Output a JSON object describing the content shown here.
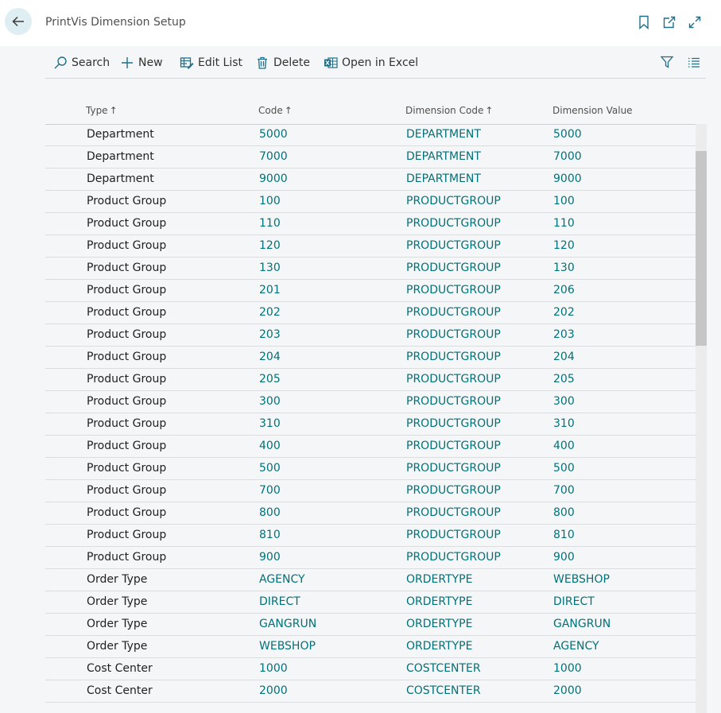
{
  "window": {
    "title": "PrintVis Dimension Setup"
  },
  "actions": {
    "search": "Search",
    "new": "New",
    "edit_list": "Edit List",
    "delete": "Delete",
    "open_in_excel": "Open in Excel"
  },
  "columns": {
    "type": "Type",
    "code": "Code",
    "dimension_code": "Dimension Code",
    "dimension_value": "Dimension Value",
    "sort_arrow": "↑"
  },
  "rows": [
    {
      "type": "Department",
      "code": "5000",
      "dimension_code": "DEPARTMENT",
      "dimension_value": "5000"
    },
    {
      "type": "Department",
      "code": "7000",
      "dimension_code": "DEPARTMENT",
      "dimension_value": "7000"
    },
    {
      "type": "Department",
      "code": "9000",
      "dimension_code": "DEPARTMENT",
      "dimension_value": "9000"
    },
    {
      "type": "Product Group",
      "code": "100",
      "dimension_code": "PRODUCTGROUP",
      "dimension_value": "100"
    },
    {
      "type": "Product Group",
      "code": "110",
      "dimension_code": "PRODUCTGROUP",
      "dimension_value": "110"
    },
    {
      "type": "Product Group",
      "code": "120",
      "dimension_code": "PRODUCTGROUP",
      "dimension_value": "120"
    },
    {
      "type": "Product Group",
      "code": "130",
      "dimension_code": "PRODUCTGROUP",
      "dimension_value": "130"
    },
    {
      "type": "Product Group",
      "code": "201",
      "dimension_code": "PRODUCTGROUP",
      "dimension_value": "206"
    },
    {
      "type": "Product Group",
      "code": "202",
      "dimension_code": "PRODUCTGROUP",
      "dimension_value": "202"
    },
    {
      "type": "Product Group",
      "code": "203",
      "dimension_code": "PRODUCTGROUP",
      "dimension_value": "203"
    },
    {
      "type": "Product Group",
      "code": "204",
      "dimension_code": "PRODUCTGROUP",
      "dimension_value": "204"
    },
    {
      "type": "Product Group",
      "code": "205",
      "dimension_code": "PRODUCTGROUP",
      "dimension_value": "205"
    },
    {
      "type": "Product Group",
      "code": "300",
      "dimension_code": "PRODUCTGROUP",
      "dimension_value": "300"
    },
    {
      "type": "Product Group",
      "code": "310",
      "dimension_code": "PRODUCTGROUP",
      "dimension_value": "310"
    },
    {
      "type": "Product Group",
      "code": "400",
      "dimension_code": "PRODUCTGROUP",
      "dimension_value": "400"
    },
    {
      "type": "Product Group",
      "code": "500",
      "dimension_code": "PRODUCTGROUP",
      "dimension_value": "500"
    },
    {
      "type": "Product Group",
      "code": "700",
      "dimension_code": "PRODUCTGROUP",
      "dimension_value": "700"
    },
    {
      "type": "Product Group",
      "code": "800",
      "dimension_code": "PRODUCTGROUP",
      "dimension_value": "800"
    },
    {
      "type": "Product Group",
      "code": "810",
      "dimension_code": "PRODUCTGROUP",
      "dimension_value": "810"
    },
    {
      "type": "Product Group",
      "code": "900",
      "dimension_code": "PRODUCTGROUP",
      "dimension_value": "900"
    },
    {
      "type": "Order Type",
      "code": "AGENCY",
      "dimension_code": "ORDERTYPE",
      "dimension_value": "WEBSHOP"
    },
    {
      "type": "Order Type",
      "code": "DIRECT",
      "dimension_code": "ORDERTYPE",
      "dimension_value": "DIRECT"
    },
    {
      "type": "Order Type",
      "code": "GANGRUN",
      "dimension_code": "ORDERTYPE",
      "dimension_value": "GANGRUN"
    },
    {
      "type": "Order Type",
      "code": "WEBSHOP",
      "dimension_code": "ORDERTYPE",
      "dimension_value": "AGENCY"
    },
    {
      "type": "Cost Center",
      "code": "1000",
      "dimension_code": "COSTCENTER",
      "dimension_value": "1000"
    },
    {
      "type": "Cost Center",
      "code": "2000",
      "dimension_code": "COSTCENTER",
      "dimension_value": "2000"
    }
  ],
  "icons": {
    "back": "back-arrow-icon",
    "bookmark": "bookmark-icon",
    "open_new_window": "open-new-window-icon",
    "expand": "expand-icon",
    "search": "search-icon",
    "new": "plus-icon",
    "edit_list": "edit-list-icon",
    "delete": "trash-icon",
    "excel": "excel-icon",
    "filter": "filter-icon",
    "list_view": "list-view-icon"
  },
  "colors": {
    "accent": "#00727a",
    "back_button_bg": "#dfeef2",
    "content_bg": "#f5f6f7"
  }
}
